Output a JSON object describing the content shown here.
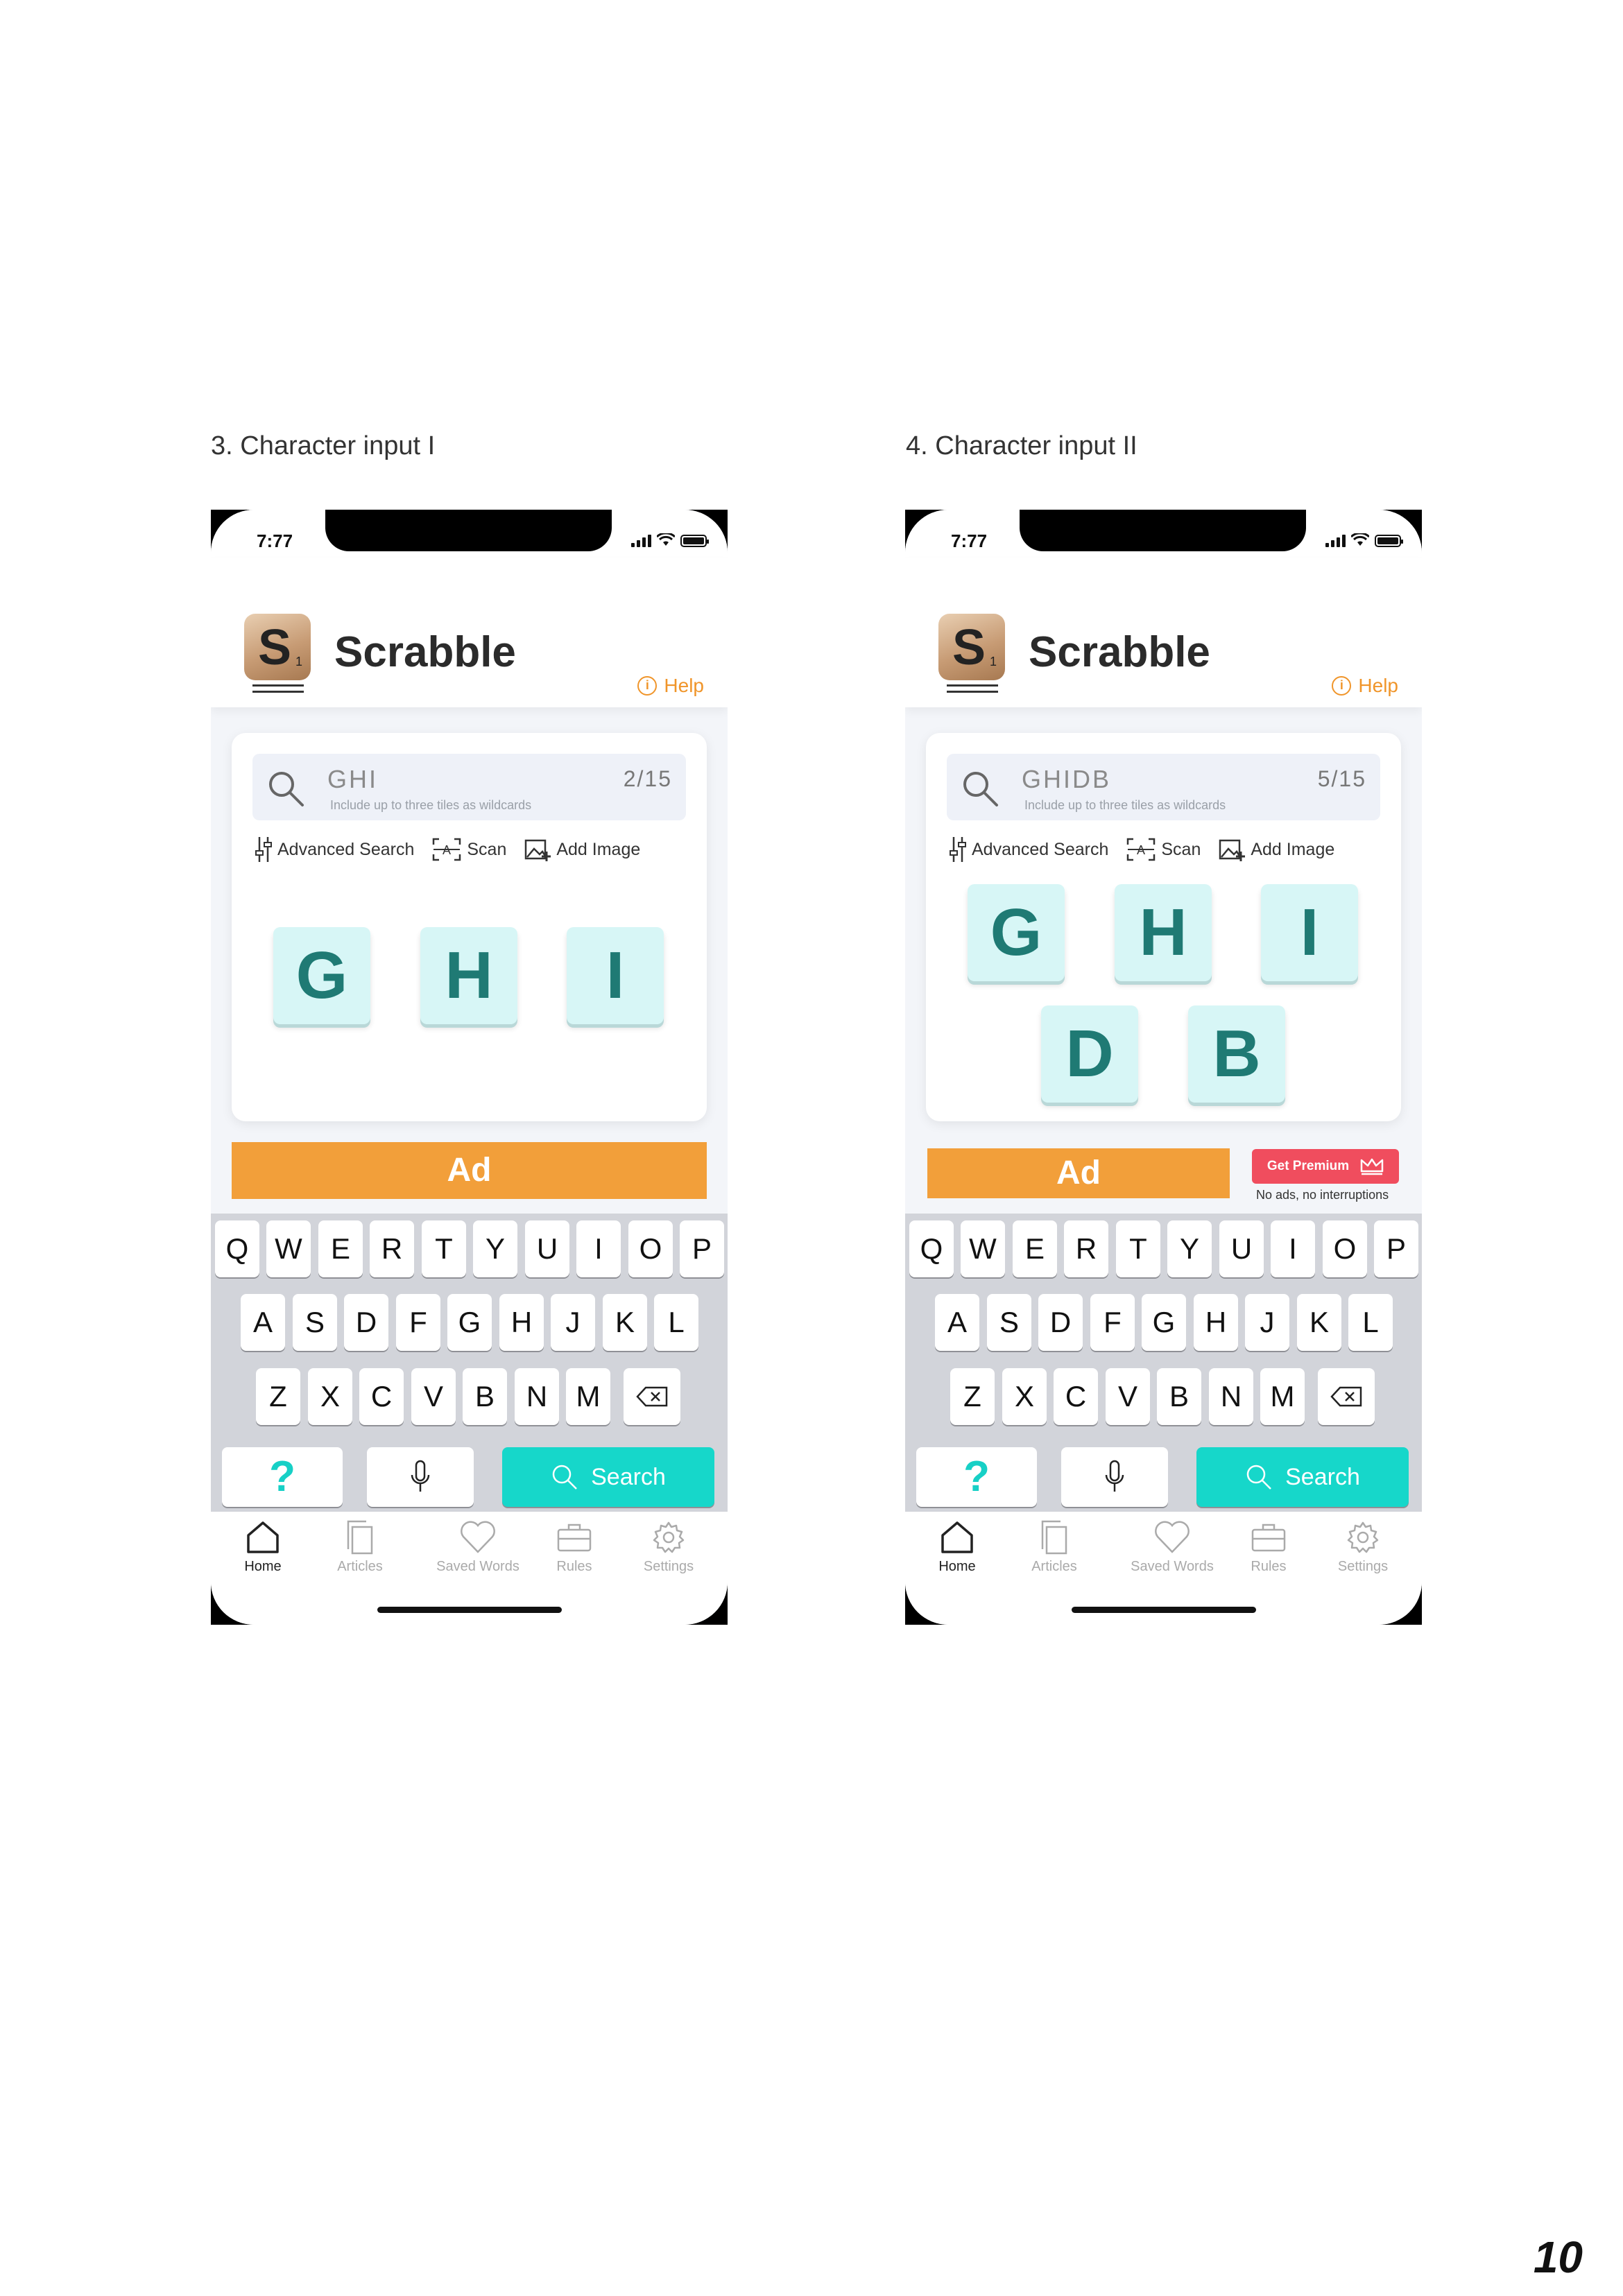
{
  "captions": [
    "3. Character input I",
    "4. Character input II"
  ],
  "phones": [
    {
      "time": "7:77",
      "app_title": "Scrabble",
      "logo_letter": "S",
      "logo_sub": "1",
      "help_label": "Help",
      "search": {
        "query": "GHI",
        "hint": "Include up to three tiles as wildcards",
        "count": "2/15"
      },
      "tools": {
        "advanced": "Advanced Search",
        "scan": "Scan",
        "add_image": "Add Image"
      },
      "tiles": [
        "G",
        "H",
        "I"
      ],
      "ad_label": "Ad",
      "keyboard": {
        "row1": [
          "Q",
          "W",
          "E",
          "R",
          "T",
          "Y",
          "U",
          "I",
          "O",
          "P"
        ],
        "row2": [
          "A",
          "S",
          "D",
          "F",
          "G",
          "H",
          "J",
          "K",
          "L"
        ],
        "row3": [
          "Z",
          "X",
          "C",
          "V",
          "B",
          "N",
          "M"
        ],
        "help_key": "?",
        "search_label": "Search"
      },
      "tabs": [
        "Home",
        "Articles",
        "Saved Words",
        "Rules",
        "Settings"
      ]
    },
    {
      "time": "7:77",
      "app_title": "Scrabble",
      "logo_letter": "S",
      "logo_sub": "1",
      "help_label": "Help",
      "search": {
        "query": "GHIDB",
        "hint": "Include up to three tiles as wildcards",
        "count": "5/15"
      },
      "tools": {
        "advanced": "Advanced Search",
        "scan": "Scan",
        "add_image": "Add Image"
      },
      "tiles": [
        "G",
        "H",
        "I",
        "D",
        "B"
      ],
      "ad_label": "Ad",
      "premium": {
        "label": "Get Premium",
        "sub": "No ads, no interruptions"
      },
      "keyboard": {
        "row1": [
          "Q",
          "W",
          "E",
          "R",
          "T",
          "Y",
          "U",
          "I",
          "O",
          "P"
        ],
        "row2": [
          "A",
          "S",
          "D",
          "F",
          "G",
          "H",
          "J",
          "K",
          "L"
        ],
        "row3": [
          "Z",
          "X",
          "C",
          "V",
          "B",
          "N",
          "M"
        ],
        "help_key": "?",
        "search_label": "Search"
      },
      "tabs": [
        "Home",
        "Articles",
        "Saved Words",
        "Rules",
        "Settings"
      ]
    }
  ],
  "page_number": "10",
  "colors": {
    "accent_teal": "#16d7ca",
    "ad_orange": "#f29f3a",
    "help_orange": "#f0952a",
    "premium_red": "#f04d5e",
    "tile_text": "#1f7a74"
  }
}
